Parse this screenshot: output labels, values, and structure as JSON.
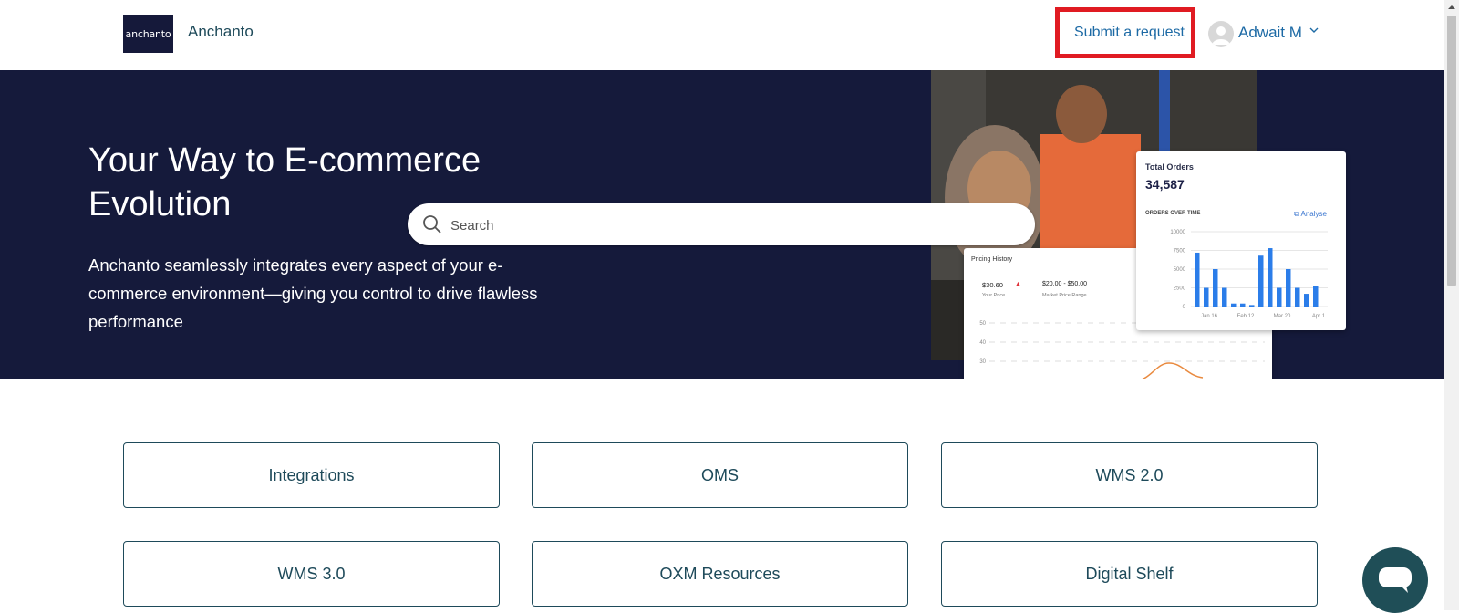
{
  "header": {
    "logo_text": "anchanto",
    "brand_name": "Anchanto",
    "submit_request": "Submit a request",
    "user_name": "Adwait M",
    "chevron": "⌄"
  },
  "hero": {
    "title": "Your Way to E-commerce Evolution",
    "description": "Anchanto seamlessly integrates every aspect of your e-commerce environment—giving you control to drive flawless performance",
    "search_placeholder": "Search",
    "orders_card": {
      "title": "Total Orders",
      "value": "34,587",
      "subtitle": "ORDERS OVER TIME",
      "analyse": "Analyse",
      "y_ticks": [
        "10000",
        "7500",
        "5000",
        "2500",
        "0"
      ],
      "x_ticks": [
        "Jan 16",
        "Feb 12",
        "Mar 20",
        "Apr 1"
      ],
      "bars": [
        0.72,
        0.25,
        0.5,
        0.25,
        0.04,
        0.04,
        0.02,
        0.68,
        0.78,
        0.25,
        0.5,
        0.25,
        0.17,
        0.27
      ]
    },
    "pricing_card": {
      "title": "Pricing History",
      "your_price": "$30.60",
      "your_price_label": "Your Price",
      "range": "$20.00 - $50.00",
      "range_label": "Market Price Range",
      "y_ticks": [
        "50",
        "40",
        "30"
      ]
    }
  },
  "categories": [
    {
      "label": "Integrations"
    },
    {
      "label": "OMS"
    },
    {
      "label": "WMS 2.0"
    },
    {
      "label": "WMS 3.0"
    },
    {
      "label": "OXM Resources"
    },
    {
      "label": "Digital Shelf"
    }
  ],
  "colors": {
    "hero_bg": "#151a3b",
    "accent_link": "#1d6aa5",
    "tile_border": "#1e4a5a",
    "highlight_box": "#e01b22",
    "chat_button": "#1f4e57"
  }
}
